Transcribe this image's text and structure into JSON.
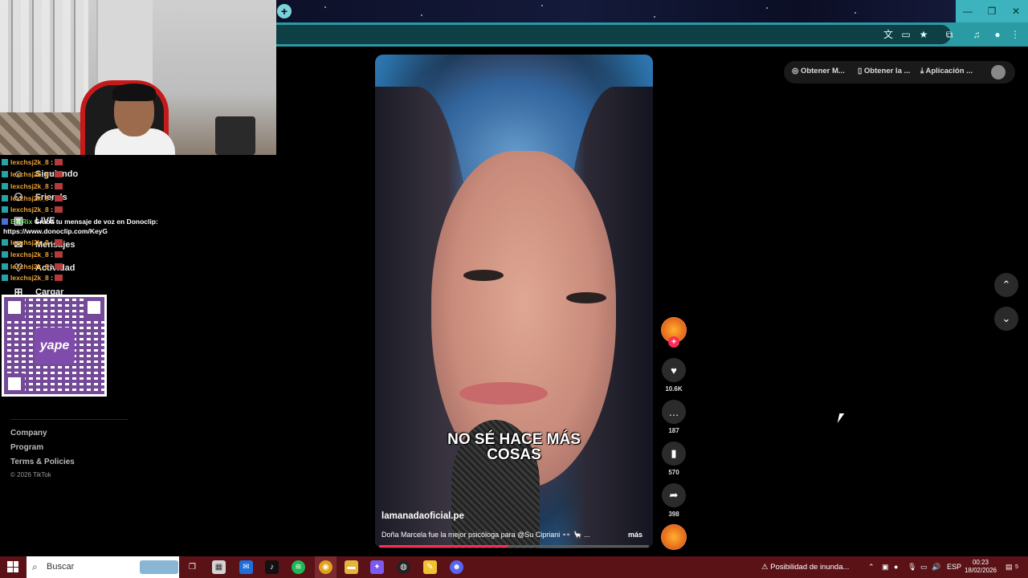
{
  "browser": {
    "new_tab_label": "+",
    "window_minimize": "—",
    "window_restore": "❐",
    "window_close": "✕",
    "accent": "#2a9aa3"
  },
  "sidebar": {
    "items": [
      {
        "label": "Siguiendo",
        "icon": "following-icon"
      },
      {
        "label": "Friends",
        "icon": "friends-icon"
      },
      {
        "label": "LIVE",
        "icon": "live-icon"
      },
      {
        "label": "Mensajes",
        "icon": "messages-icon"
      },
      {
        "label": "Actividad",
        "icon": "activity-icon"
      },
      {
        "label": "Cargar",
        "icon": "upload-icon"
      }
    ],
    "footer_links": [
      "Company",
      "Program",
      "Terms & Policies"
    ],
    "copyright": "© 2026 TikTok"
  },
  "chat": {
    "messages": [
      {
        "user": "lexchsj2k_8",
        "sep": " :"
      },
      {
        "user": "lexchsj2k_8",
        "sep": " :"
      },
      {
        "user": "lexchsj2k_8",
        "sep": " :"
      },
      {
        "user": "lexchsj2k_8",
        "sep": " :"
      },
      {
        "user": "lexchsj2k_8",
        "sep": " :"
      }
    ],
    "bot_user": "BotRix",
    "bot_line1": "Graba tu mensaje de voz en Donoclip:",
    "bot_line2": "https://www.donoclip.com/KeyG",
    "messages2": [
      {
        "user": "lexchsj2k_8",
        "sep": " :"
      },
      {
        "user": "lexchsj2k_8",
        "sep": " :"
      },
      {
        "user": "lexchsj2k_8",
        "sep": " :"
      },
      {
        "user": "lexchsj2k_8",
        "sep": " :"
      }
    ],
    "qr_label": "yape"
  },
  "video": {
    "caption_line1": "NO SÉ HACE MÁS",
    "caption_line2": "COSAS",
    "author": "lamanadaoficial.pe",
    "description": "Doña Marcela fue la mejor psicóloga para @Su Cipriani 👓 🦙 ...",
    "more_label": "más",
    "progress_fraction": 0.48
  },
  "actions": {
    "likes": "10.6K",
    "comments": "187",
    "saves": "570",
    "shares": "398"
  },
  "header_pills": {
    "get_coins": "Obtener M...",
    "get_app": "Obtener la ...",
    "app": "Aplicación ..."
  },
  "taskbar": {
    "search_placeholder": "Buscar",
    "alert": "Posibilidad de inunda...",
    "lang": "ESP",
    "time": "00:23",
    "date": "18/02/2026",
    "notif_count": "5"
  }
}
